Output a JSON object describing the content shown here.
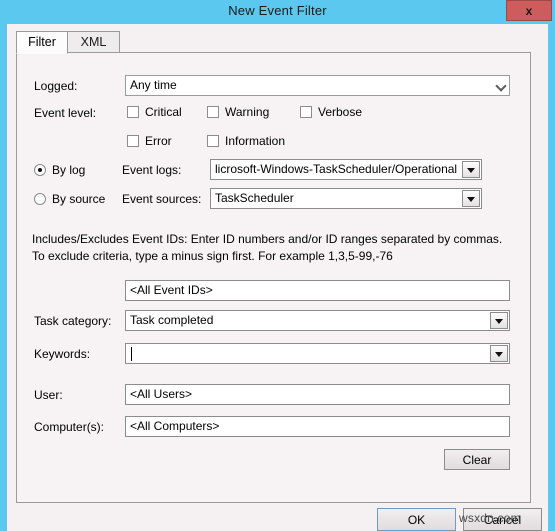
{
  "window": {
    "title": "New Event Filter",
    "close_label": "x"
  },
  "tabs": [
    {
      "label": "Filter",
      "active": true
    },
    {
      "label": "XML",
      "active": false
    }
  ],
  "form": {
    "logged": {
      "label": "Logged:",
      "value": "Any time"
    },
    "event_level": {
      "label": "Event level:",
      "checkboxes": [
        {
          "label": "Critical",
          "checked": false
        },
        {
          "label": "Warning",
          "checked": false
        },
        {
          "label": "Verbose",
          "checked": false
        },
        {
          "label": "Error",
          "checked": false
        },
        {
          "label": "Information",
          "checked": false
        }
      ]
    },
    "by_log": {
      "radio_label": "By log",
      "selected": true,
      "field_label": "Event logs:",
      "value": "licrosoft-Windows-TaskScheduler/Operational"
    },
    "by_source": {
      "radio_label": "By source",
      "selected": false,
      "field_label": "Event sources:",
      "value": "TaskScheduler"
    },
    "event_ids": {
      "help_text": "Includes/Excludes Event IDs: Enter ID numbers and/or ID ranges separated by commas. To exclude criteria, type a minus sign first. For example 1,3,5-99,-76",
      "value": "<All Event IDs>"
    },
    "task_category": {
      "label": "Task category:",
      "value": "Task completed"
    },
    "keywords": {
      "label": "Keywords:",
      "value": ""
    },
    "user": {
      "label": "User:",
      "value": "<All Users>"
    },
    "computers": {
      "label": "Computer(s):",
      "value": "<All Computers>"
    },
    "clear_button": "Clear"
  },
  "footer": {
    "ok_label": "OK",
    "cancel_label": "Cancel"
  },
  "overlay": {
    "watermark": "wsxdn.com"
  },
  "colors": {
    "titlebar": "#5bc8ef",
    "close_button": "#cd5c5c",
    "panel": "#f7f3f5",
    "client": "#f5f1f3"
  }
}
